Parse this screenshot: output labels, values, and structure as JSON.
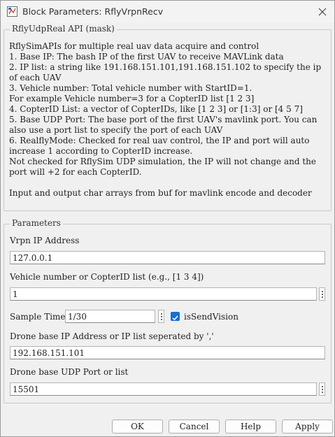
{
  "window": {
    "title": "Block Parameters: RflyVrpnRecv",
    "icon": "simulink-block-icon"
  },
  "mask_group": {
    "legend": "RflyUdpReal API (mask)",
    "description": "RflySimAPIs for multiple real uav data acquire and control\n1. Base IP: The bash IP of the first UAV to receive MAVLink data\n2. IP list: a string like 191.168.151.101,191.168.151.102 to specify the ip of each UAV\n3. Vehicle number: Total vehicle number with StartID=1.\nFor example Vehicle number=3 for a CopterID list [1 2 3]\n4. CopterID List: a vector of CopterIDs, like [1 2 3] or [1:3] or [4 5 7]\n5. Base UDP Port: The base port of the first UAV's mavlink port. You can also use a port list to specify the port of each UAV\n6. RealflyMode: Checked for real uav control, the IP and port will auto increase 1 according to CopterID increase.\nNot checked for RflySim UDP simulation, the IP will not change and the port will +2 for each CopterID.\n\nInput and output char arrays from buf for mavlink encode and decoder"
  },
  "parameters": {
    "legend": "Parameters",
    "vrpn_ip_label": "Vrpn IP Address",
    "vrpn_ip_value": "127.0.0.1",
    "vehicle_label": "Vehicle number or CopterID list (e.g., [1 3 4])",
    "vehicle_value": "1",
    "sample_time_label": "Sample Time",
    "sample_time_value": "1/30",
    "is_send_vision_label": "isSendVision",
    "is_send_vision_checked": true,
    "drone_ip_label": "Drone base IP Address or IP list seperated by ','",
    "drone_ip_value": "192.168.151.101",
    "drone_port_label": "Drone base UDP Port or list",
    "drone_port_value": "15501"
  },
  "buttons": {
    "ok": "OK",
    "cancel": "Cancel",
    "help": "Help",
    "apply": "Apply"
  },
  "colors": {
    "accent": "#1a6fd0",
    "background": "#f0f0f0"
  }
}
